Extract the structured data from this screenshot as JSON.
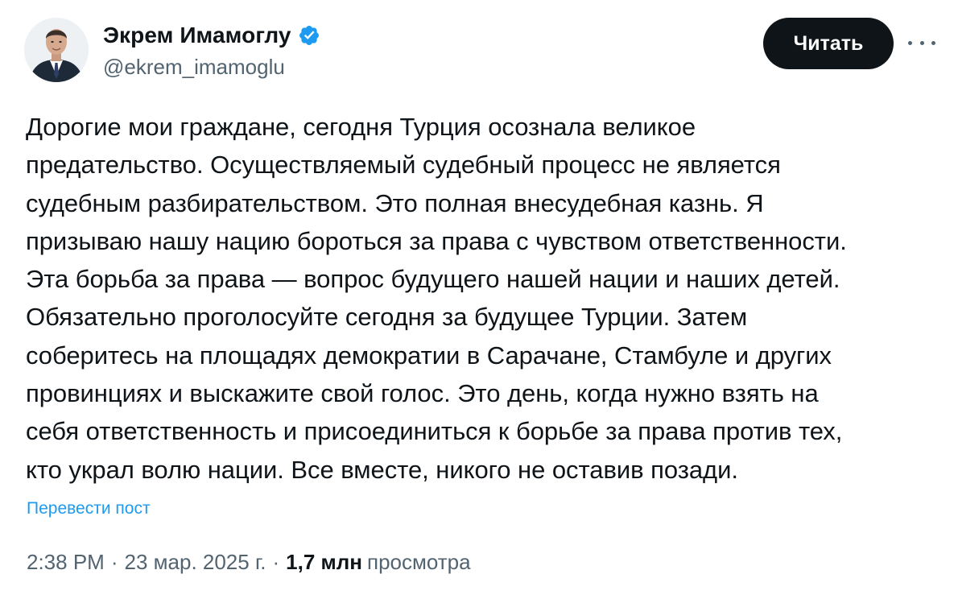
{
  "author": {
    "display_name": "Экрем Имамоглу",
    "handle": "@ekrem_imamoglu",
    "verified": true
  },
  "actions": {
    "follow_label": "Читать"
  },
  "tweet": {
    "text": "Дорогие мои граждане, сегодня Турция осознала великое\nпредательство. Осуществляемый судебный процесс не является\nсудебным разбирательством. Это полная внесудебная казнь. Я\nпризываю нашу нацию бороться за права с чувством ответственности.\nЭта борьба за права — вопрос будущего нашей нации и наших детей.\nОбязательно проголосуйте сегодня за будущее Турции. Затем\nсоберитесь на площадях демократии в Сарачане, Стамбуле и других\nпровинциях и выскажите свой голос. Это день, когда нужно взять на\nсебя ответственность и присоединиться к борьбе за права против тех,\nкто украл волю нации. Все вместе, никого не оставив позади.",
    "translate_label": "Перевести пост"
  },
  "meta": {
    "time": "2:38 PM",
    "separator": "·",
    "date": "23 мар. 2025 г.",
    "views_count": "1,7 млн",
    "views_label": "просмотра"
  },
  "colors": {
    "text_primary": "#0f1419",
    "text_secondary": "#536471",
    "link": "#1d9bf0",
    "verified_badge": "#1d9bf0",
    "button_bg": "#0f1419"
  },
  "icons": {
    "verified": "verified-badge-icon",
    "more": "more-horizontal-icon"
  }
}
